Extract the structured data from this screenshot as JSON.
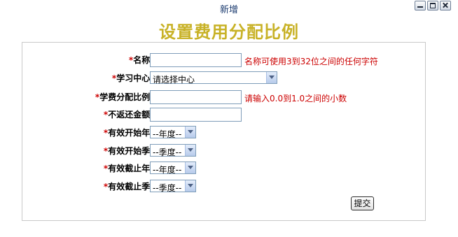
{
  "window": {
    "title": "新增"
  },
  "page": {
    "title": "设置费用分配比例"
  },
  "form": {
    "required_mark": "*",
    "name": {
      "label": "名称:",
      "value": "",
      "hint": "名称可使用3到32位之间的任何字符"
    },
    "center": {
      "label": "学习中心:",
      "selected": "请选择中心"
    },
    "ratio": {
      "label": "学费分配比例:",
      "value": "",
      "hint": "请输入0.0到1.0之间的小数"
    },
    "nonrefund": {
      "label": "不返还金额:",
      "value": ""
    },
    "start_year": {
      "label": "有效开始年:",
      "selected": "--年度--"
    },
    "start_quarter": {
      "label": "有效开始季:",
      "selected": "--季度--"
    },
    "end_year": {
      "label": "有效截止年:",
      "selected": "--年度--"
    },
    "end_quarter": {
      "label": "有效截止季:",
      "selected": "--季度--"
    },
    "submit_label": "提交"
  }
}
